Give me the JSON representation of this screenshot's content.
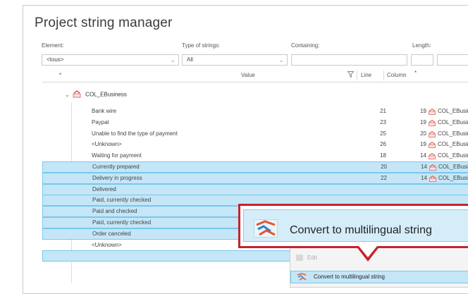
{
  "title": "Project string manager",
  "filters": {
    "element_label": "Element:",
    "element_value": "<tous>",
    "type_label": "Type of strings:",
    "type_value": "All",
    "containing_label": "Containing:",
    "containing_value": "",
    "length_label": "Length:",
    "length_value": ""
  },
  "columns": {
    "asterisk": "*",
    "value": "Value",
    "line": "Line",
    "column": "Column",
    "column_suffix": "*"
  },
  "group": {
    "label": "COL_EBusiness"
  },
  "rows": [
    {
      "value": "Bank wire",
      "line": "21",
      "column": "19",
      "ref": "COL_EBusin",
      "selected": false
    },
    {
      "value": "Paypal",
      "line": "23",
      "column": "19",
      "ref": "COL_EBusin",
      "selected": false
    },
    {
      "value": "Unable to find the type of payment",
      "line": "25",
      "column": "20",
      "ref": "COL_EBusin",
      "selected": false
    },
    {
      "value": "<Unknown>",
      "line": "26",
      "column": "19",
      "ref": "COL_EBusin",
      "selected": false
    },
    {
      "value": "Waiting for payment",
      "line": "18",
      "column": "14",
      "ref": "COL_EBusin",
      "selected": false
    },
    {
      "value": "Currently prepared",
      "line": "20",
      "column": "14",
      "ref": "COL_EBusin",
      "selected": true
    },
    {
      "value": "Delivery in progress",
      "line": "22",
      "column": "14",
      "ref": "COL_EBusin",
      "selected": true
    },
    {
      "value": "Delivered",
      "line": "",
      "column": "",
      "ref": "",
      "selected": true
    },
    {
      "value": "Paid, currently checked",
      "line": "",
      "column": "",
      "ref": "",
      "selected": true
    },
    {
      "value": "Paid and checked",
      "line": "",
      "column": "",
      "ref": "",
      "selected": true
    },
    {
      "value": "Paid, currently checked",
      "line": "",
      "column": "",
      "ref": "",
      "selected": true
    },
    {
      "value": "Order canceled",
      "line": "",
      "column": "",
      "ref": "",
      "selected": true
    },
    {
      "value": "<Unknown>",
      "line": "",
      "column": "",
      "ref": "",
      "selected": false
    },
    {
      "value": "",
      "line": "",
      "column": "",
      "ref": "",
      "selected": true
    }
  ],
  "context_menu": {
    "edit_label": "Edit",
    "convert_label": "Convert to multilingual string"
  },
  "callout": {
    "label": "Convert to multilingual string",
    "border_color": "#c5232f"
  },
  "colors": {
    "selection_bg": "#c4e6f7",
    "selection_border": "#77c7ec",
    "accent_red": "#c5232f"
  }
}
